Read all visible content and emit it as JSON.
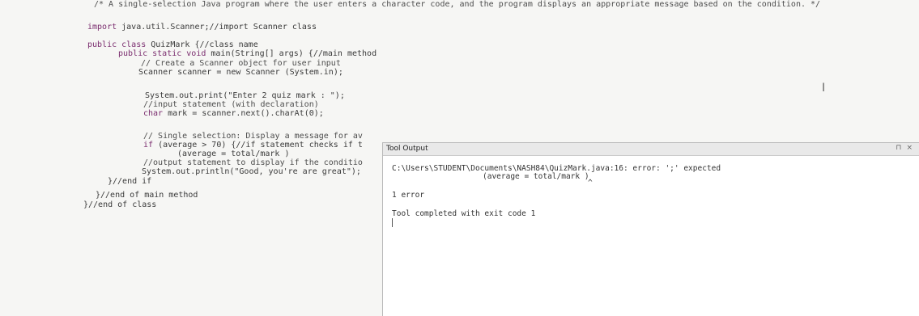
{
  "code": {
    "line1": "/* A single-selection Java program where the user enters a character code, and the program displays an appropriate message based on the condition. */",
    "line2_kw": "import",
    "line2_rest": " java.util.Scanner;//import Scanner class",
    "line3_kw": "public class",
    "line3_rest": " QuizMark {//class name",
    "line4_kw": "public static void",
    "line4_rest": " main(String[] args) {//main method",
    "line5": "// Create a Scanner object for user input",
    "line6": "Scanner scanner = new Scanner (System.in);",
    "line7": "System.out.print(\"Enter 2 quiz mark : \");",
    "line8": "//input statement (with declaration)",
    "line9_kw": "char",
    "line9_rest": " mark = scanner.next().charAt(0);",
    "line10": "// Single selection: Display a message for av",
    "line11_kw": "if",
    "line11_rest": " (average > 70) {//if statement checks if t",
    "line12": "(average = total/mark )",
    "line13": "//output statement to display if the conditio",
    "line14": "System.out.println(\"Good, you're are great\");",
    "line15": "}//end if",
    "line16": "}//end of main method",
    "line17": "}//end of class"
  },
  "tool_output": {
    "title": "Tool Output",
    "pin": "⊓",
    "close": "×",
    "error_path": "C:\\Users\\STUDENT\\Documents\\NASH84\\QuizMark.java:16: error: ';' expected",
    "error_context": "(average = total/mark )",
    "error_marker": "^",
    "error_count": "1 error",
    "completion": "Tool completed with exit code 1"
  }
}
